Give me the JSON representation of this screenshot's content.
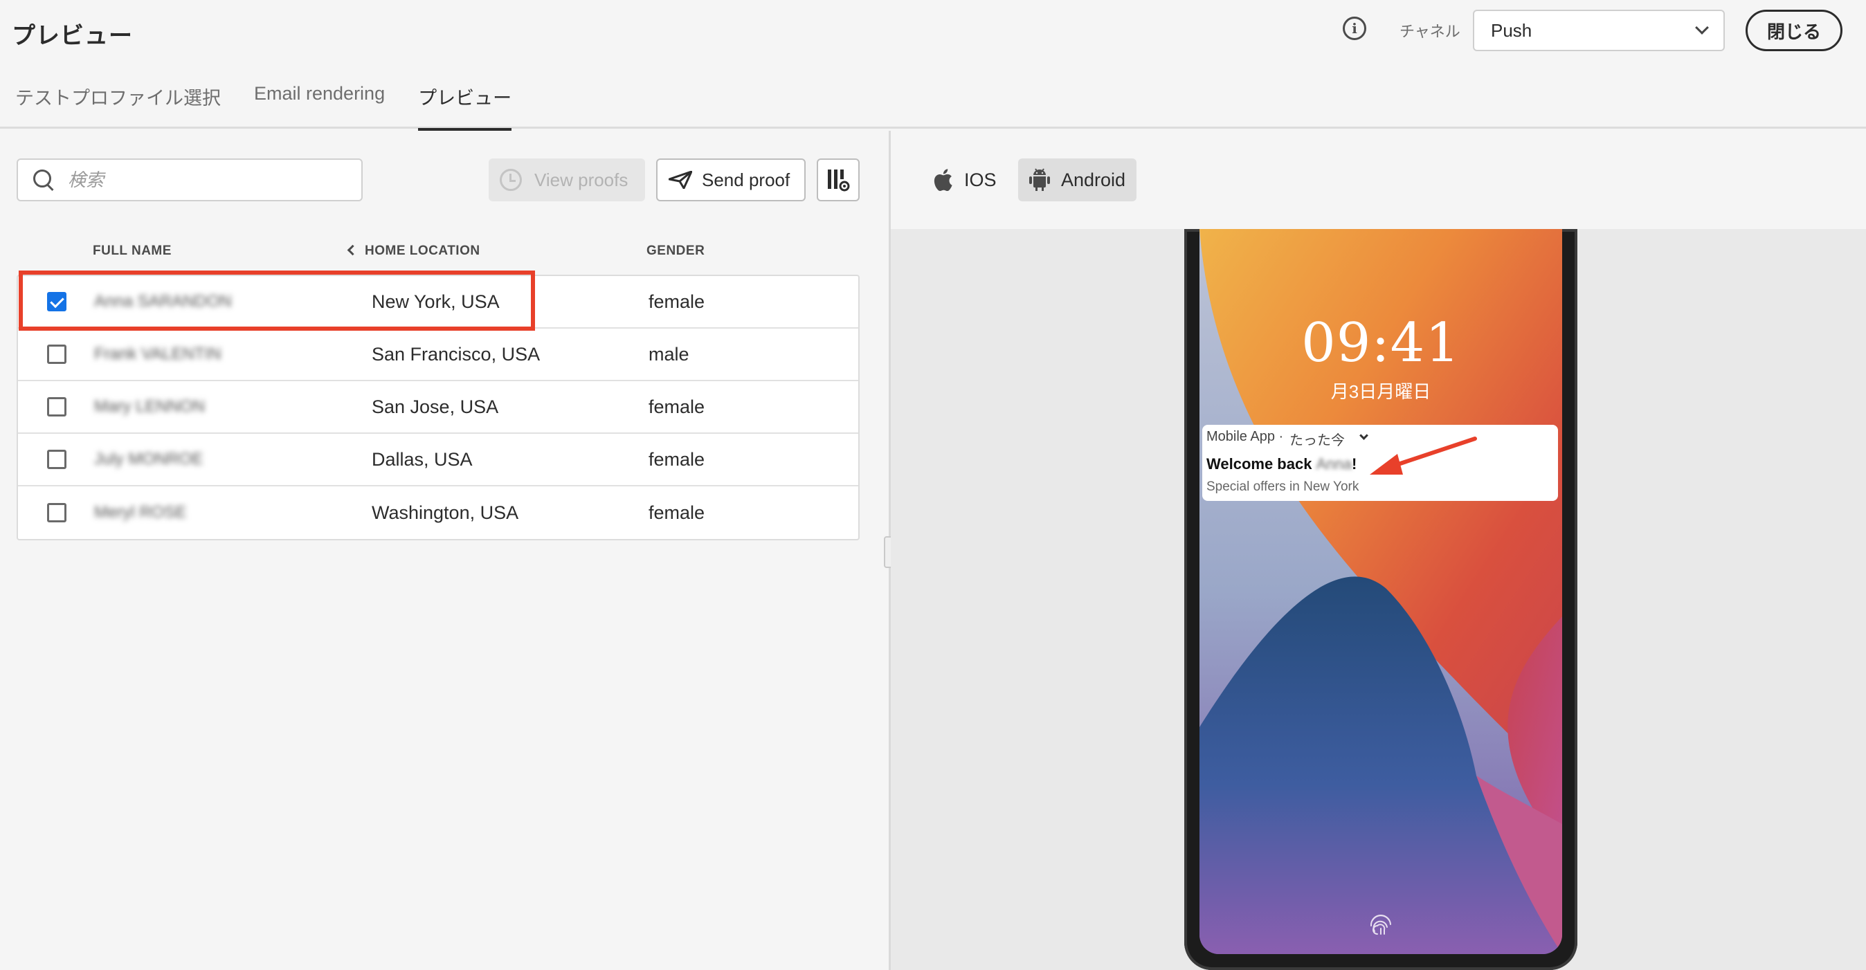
{
  "header": {
    "title": "プレビュー",
    "channel_label": "チャネル",
    "channel_value": "Push",
    "close_label": "閉じる"
  },
  "tabs": [
    {
      "label": "テストプロファイル選択",
      "active": false
    },
    {
      "label": "Email rendering",
      "active": false
    },
    {
      "label": "プレビュー",
      "active": true
    }
  ],
  "toolbar": {
    "search_placeholder": "検索",
    "view_proofs_label": "View proofs",
    "send_proof_label": "Send proof"
  },
  "table": {
    "columns": [
      "FULL NAME",
      "HOME LOCATION",
      "GENDER"
    ],
    "rows": [
      {
        "name": "Anna SARANDON",
        "location": "New York, USA",
        "gender": "female",
        "selected": true
      },
      {
        "name": "Frank VALENTIN",
        "location": "San Francisco, USA",
        "gender": "male",
        "selected": false
      },
      {
        "name": "Mary LENNON",
        "location": "San Jose, USA",
        "gender": "female",
        "selected": false
      },
      {
        "name": "July MONROE",
        "location": "Dallas, USA",
        "gender": "female",
        "selected": false
      },
      {
        "name": "Meryl ROSE",
        "location": "Washington, USA",
        "gender": "female",
        "selected": false
      }
    ]
  },
  "device_tabs": {
    "ios_label": "IOS",
    "android_label": "Android",
    "selected": "Android"
  },
  "phone": {
    "time": "09:41",
    "date": "月3日月曜日",
    "notification": {
      "app_name": "Mobile App ·",
      "time": "たった今",
      "title_prefix": "Welcome back ",
      "title_name": "Anna",
      "title_suffix": "!",
      "subtitle": "Special offers in New York"
    }
  },
  "colors": {
    "accent": "#1473e6",
    "highlight": "#e8402a"
  }
}
